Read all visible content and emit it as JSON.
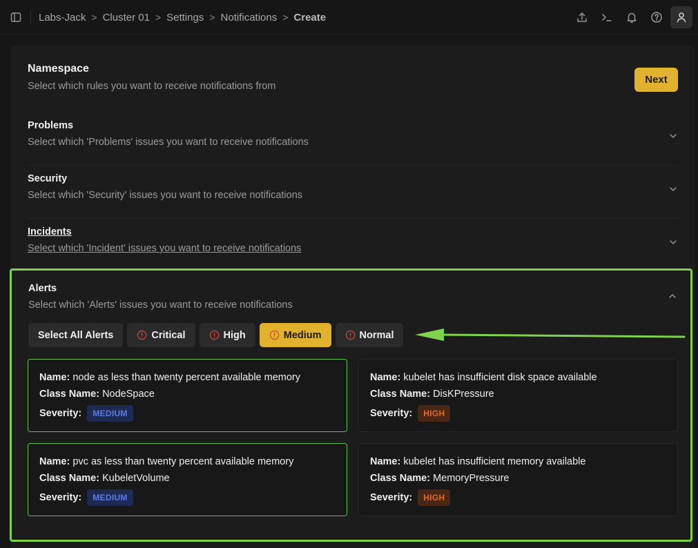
{
  "breadcrumb": {
    "items": [
      "Labs-Jack",
      "Cluster 01",
      "Settings",
      "Notifications"
    ],
    "current": "Create",
    "separator": ">"
  },
  "header_icons": [
    "sidebar-toggle-icon",
    "upload-icon",
    "terminal-icon",
    "bell-icon",
    "help-icon",
    "user-icon"
  ],
  "namespace": {
    "title": "Namespace",
    "subtitle": "Select which rules you want to receive notifications from",
    "next_label": "Next"
  },
  "sections": [
    {
      "title": "Problems",
      "subtitle": "Select which 'Problems' issues you want to receive notifications"
    },
    {
      "title": "Security",
      "subtitle": "Select which 'Security' issues you want to receive notifications"
    },
    {
      "title": "Incidents",
      "subtitle": "Select which 'Incident' issues you want to receive notifications"
    }
  ],
  "alerts": {
    "title": "Alerts",
    "subtitle": "Select which 'Alerts' issues you want to receive notifications",
    "select_all_label": "Select All Alerts",
    "filters": [
      {
        "label": "Critical",
        "selected": false
      },
      {
        "label": "High",
        "selected": false
      },
      {
        "label": "Medium",
        "selected": true
      },
      {
        "label": "Normal",
        "selected": false
      }
    ],
    "field_labels": {
      "name": "Name:",
      "class_name": "Class Name:",
      "severity": "Severity:"
    },
    "cards": [
      {
        "name": "node as less than twenty percent available memory",
        "class_name": "NodeSpace",
        "severity": "MEDIUM",
        "selected": true
      },
      {
        "name": "kubelet has insufficient disk space available",
        "class_name": "DisKPressure",
        "severity": "HIGH",
        "selected": false
      },
      {
        "name": "pvc as less than twenty percent available memory",
        "class_name": "KubeletVolume",
        "severity": "MEDIUM",
        "selected": true
      },
      {
        "name": "kubelet has insufficient memory available",
        "class_name": "MemoryPressure",
        "severity": "HIGH",
        "selected": false
      }
    ]
  },
  "colors": {
    "accent": "#e2b22e",
    "highlight_border": "#7fd24b",
    "selected_card_border": "#5fc14a",
    "medium_badge": "#5b7be8",
    "high_badge": "#e36a2a",
    "alert_icon": "#e0413a"
  }
}
